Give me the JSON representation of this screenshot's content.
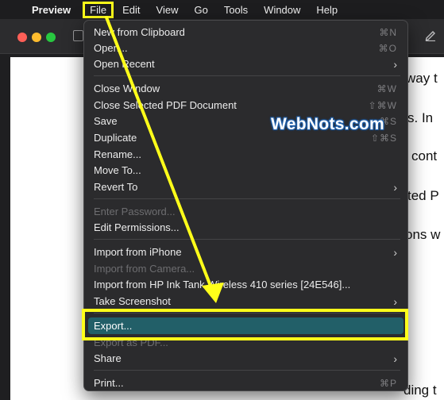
{
  "menubar": {
    "app_name": "Preview",
    "menus": [
      "File",
      "Edit",
      "View",
      "Go",
      "Tools",
      "Window",
      "Help"
    ]
  },
  "document": {
    "lines": [
      "way t",
      "s. In",
      "cont",
      "ted P",
      "ons w",
      "ding t"
    ]
  },
  "file_menu": {
    "items": [
      {
        "label": "New from Clipboard",
        "shortcut": "⌘N"
      },
      {
        "label": "Open...",
        "shortcut": "⌘O"
      },
      {
        "label": "Open Recent",
        "submenu": "›"
      },
      {
        "label": "Close Window",
        "shortcut": "⌘W"
      },
      {
        "label": "Close Selected PDF Document",
        "shortcut": "⇧⌘W"
      },
      {
        "label": "Save",
        "shortcut": "⌘S"
      },
      {
        "label": "Duplicate",
        "shortcut": "⇧⌘S"
      },
      {
        "label": "Rename..."
      },
      {
        "label": "Move To..."
      },
      {
        "label": "Revert To",
        "submenu": "›"
      },
      {
        "label": "Enter Password..."
      },
      {
        "label": "Edit Permissions..."
      },
      {
        "label": "Import from iPhone",
        "submenu": "›"
      },
      {
        "label": "Import from Camera..."
      },
      {
        "label": "Import from HP Ink Tank Wireless 410 series [24E546]..."
      },
      {
        "label": "Take Screenshot",
        "submenu": "›"
      },
      {
        "label": "Export..."
      },
      {
        "label": "Export as PDF..."
      },
      {
        "label": "Share",
        "submenu": "›"
      },
      {
        "label": "Print...",
        "shortcut": "⌘P"
      }
    ]
  },
  "watermark": "WebNots.com",
  "colors": {
    "highlight": "#225f68",
    "annotation": "#ffff1a"
  }
}
